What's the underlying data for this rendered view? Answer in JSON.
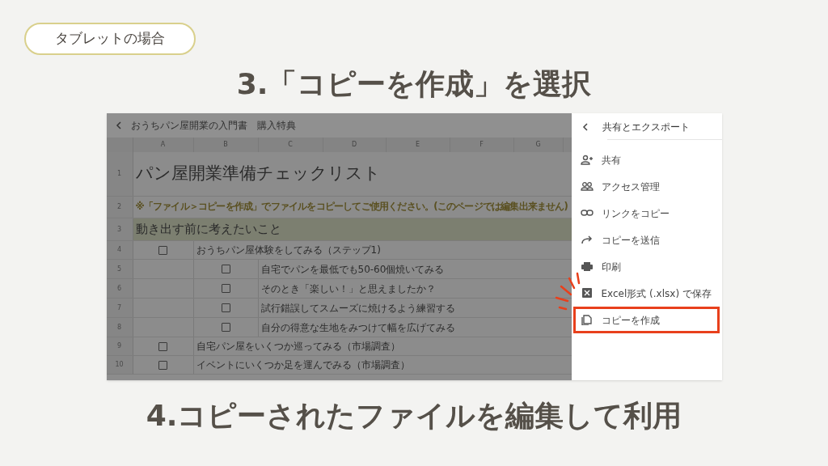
{
  "badge": "タブレットの場合",
  "heading": "3.「コピーを作成」を選択",
  "screenshot": {
    "sheet": {
      "title": "おうちパン屋開業の入門書　購入特典",
      "columns": [
        "A",
        "B",
        "C",
        "D",
        "E",
        "F",
        "G"
      ],
      "rows": [
        {
          "number": "1",
          "kind": "title",
          "text": "パン屋開業準備チェックリスト"
        },
        {
          "number": "2",
          "kind": "note",
          "text": "※「ファイル＞コピーを作成」でファイルをコピーしてご使用ください。(このページでは編集出来ません)"
        },
        {
          "number": "3",
          "kind": "section",
          "text": "動き出す前に考えたいこと"
        },
        {
          "number": "4",
          "kind": "item",
          "text": "おうちパン屋体験をしてみる（ステップ1)",
          "checked": false
        },
        {
          "number": "5",
          "kind": "subitem",
          "text": "自宅でパンを最低でも50-60個焼いてみる",
          "checked": false
        },
        {
          "number": "6",
          "kind": "subitem",
          "text": "そのとき「楽しい！」と思えましたか？",
          "checked": false
        },
        {
          "number": "7",
          "kind": "subitem",
          "text": "試行錯誤してスムーズに焼けるよう練習する",
          "checked": false
        },
        {
          "number": "8",
          "kind": "subitem",
          "text": "自分の得意な生地をみつけて幅を広げてみる",
          "checked": false
        },
        {
          "number": "9",
          "kind": "item",
          "text": "自宅パン屋をいくつか巡ってみる（市場調査）",
          "checked": false
        },
        {
          "number": "10",
          "kind": "item",
          "text": "イベントにいくつか足を運んでみる（市場調査）",
          "checked": false
        }
      ]
    },
    "menu": {
      "title": "共有とエクスポート",
      "items": [
        {
          "kind": "add-person",
          "label": "共有",
          "highlighted": false
        },
        {
          "kind": "people",
          "label": "アクセス管理",
          "highlighted": false
        },
        {
          "kind": "link",
          "label": "リンクをコピー",
          "highlighted": false
        },
        {
          "kind": "forward",
          "label": "コピーを送信",
          "highlighted": false
        },
        {
          "kind": "print",
          "label": "印刷",
          "highlighted": false
        },
        {
          "kind": "excel",
          "label": "Excel形式 (.xlsx) で保存",
          "highlighted": false
        },
        {
          "kind": "copy",
          "label": "コピーを作成",
          "highlighted": true
        }
      ]
    }
  },
  "footer": "4.コピーされたファイルを編集して利用"
}
